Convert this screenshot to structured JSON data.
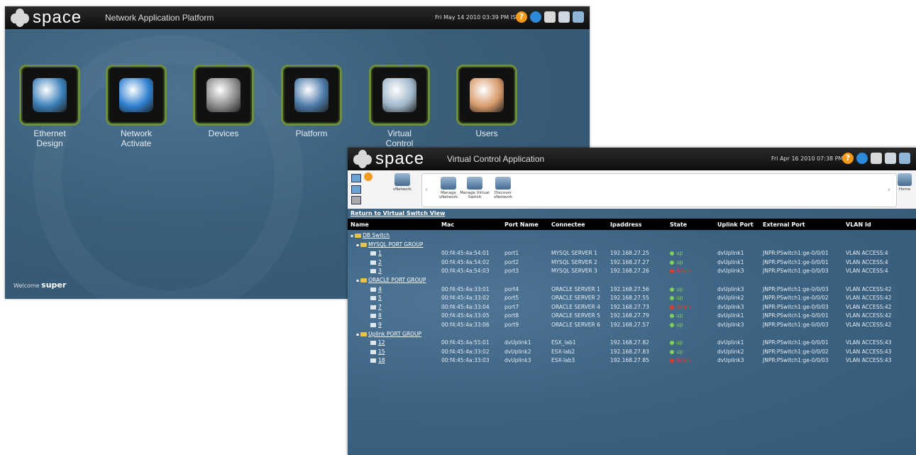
{
  "back_window": {
    "logo_text": "space",
    "title": "Network Application Platform",
    "clock": "Fri May 14 2010 03:39 PM IST",
    "tiles": [
      {
        "label": "Ethernet\nDesign",
        "icon": "cloud-building-icon"
      },
      {
        "label": "Network\nActivate",
        "icon": "globe-network-icon"
      },
      {
        "label": "Devices",
        "icon": "server-rack-icon"
      },
      {
        "label": "Platform",
        "icon": "platform-window-icon"
      },
      {
        "label": "Virtual\nControl",
        "icon": "virtual-device-icon"
      },
      {
        "label": "Users",
        "icon": "user-person-icon"
      }
    ],
    "welcome_label": "Welcome",
    "welcome_user": "super"
  },
  "front_window": {
    "logo_text": "space",
    "title": "Virtual Control Application",
    "clock": "Fri Apr 16 2010 07:38 PM IST",
    "toolbar": {
      "items": [
        {
          "label": "vNetwork"
        },
        {
          "label": "Manage\nvNetwork"
        },
        {
          "label": "Manage Virtual\nSwitch"
        },
        {
          "label": "Discover\nvNetwork"
        }
      ],
      "home_label": "Home"
    },
    "return_link": "Return to Virtual Switch View",
    "columns": [
      "Name",
      "Mac",
      "Port Name",
      "Connectee",
      "Ipaddress",
      "State",
      "Uplink Port",
      "External Port",
      "VLAN Id"
    ],
    "tree": {
      "root": "DB Switch",
      "groups": [
        {
          "name": "MYSQL PORT GROUP",
          "rows": [
            {
              "name": "1",
              "mac": "00:f4:45:4a:54:01",
              "port": "port1",
              "connectee": "MYSQL SERVER 1",
              "ip": "192.168.27.25",
              "state": "up",
              "uplink": "dvUplink1",
              "external": "JNPR:PSwitch1:ge-0/0/01",
              "vlan": "VLAN ACCESS:4"
            },
            {
              "name": "2",
              "mac": "00:f4:45:4a:54:02",
              "port": "port2",
              "connectee": "MYSQL SERVER 2",
              "ip": "192.168.27.27",
              "state": "up",
              "uplink": "dvUplink1",
              "external": "JNPR:PSwitch1:ge-0/0/01",
              "vlan": "VLAN ACCESS:4"
            },
            {
              "name": "3",
              "mac": "00:f4:45:4a:54:03",
              "port": "port3",
              "connectee": "MYSQL SERVER 3",
              "ip": "192.168.27.26",
              "state": "down",
              "uplink": "dvUplink3",
              "external": "JNPR:PSwitch1:ge-0/0/03",
              "vlan": "VLAN ACCESS:4"
            }
          ]
        },
        {
          "name": "ORACLE PORT GROUP",
          "rows": [
            {
              "name": "4",
              "mac": "00:f4:45:4a:33:01",
              "port": "port4",
              "connectee": "ORACLE SERVER 1",
              "ip": "192.168.27.56",
              "state": "up",
              "uplink": "dvUplink3",
              "external": "JNPR:PSwitch1:ge-0/0/03",
              "vlan": "VLAN ACCESS:42"
            },
            {
              "name": "5",
              "mac": "00:f4:45:4a:33:02",
              "port": "port5",
              "connectee": "ORACLE SERVER 2",
              "ip": "192.168.27.55",
              "state": "up",
              "uplink": "dvUplink2",
              "external": "JNPR:PSwitch1:ge-0/0/02",
              "vlan": "VLAN ACCESS:42"
            },
            {
              "name": "7",
              "mac": "00:f4:45:4a:33:04",
              "port": "port7",
              "connectee": "ORACLE SERVER 4",
              "ip": "192.168.27.73",
              "state": "down",
              "uplink": "dvUplink3",
              "external": "JNPR:PSwitch1:ge-0/0/03",
              "vlan": "VLAN ACCESS:42"
            },
            {
              "name": "8",
              "mac": "00:f4:45:4a:33:05",
              "port": "port8",
              "connectee": "ORACLE SERVER 5",
              "ip": "192.168.27.79",
              "state": "up",
              "uplink": "dvUplink1",
              "external": "JNPR:PSwitch1:ge-0/0/01",
              "vlan": "VLAN ACCESS:42"
            },
            {
              "name": "9",
              "mac": "00:f4:45:4a:33:06",
              "port": "port9",
              "connectee": "ORACLE SERVER 6",
              "ip": "192.168.27.57",
              "state": "up",
              "uplink": "dvUplink3",
              "external": "JNPR:PSwitch1:ge-0/0/03",
              "vlan": "VLAN ACCESS:42"
            }
          ]
        },
        {
          "name": "Uplink PORT GROUP",
          "rows": [
            {
              "name": "12",
              "mac": "00:f4:45:4a:55:01",
              "port": "dvUplink1",
              "connectee": "ESX_lab1",
              "ip": "192.168.27.82",
              "state": "up",
              "uplink": "dvUplink1",
              "external": "JNPR:PSwitch1:ge-0/0/01",
              "vlan": "VLAN ACCESS:43"
            },
            {
              "name": "15",
              "mac": "00:f4:45:4a:33:02",
              "port": "dvUplink2",
              "connectee": "ESX-lab2",
              "ip": "192.168.27.83",
              "state": "up",
              "uplink": "dvUplink2",
              "external": "JNPR:PSwitch1:ge-0/0/02",
              "vlan": "VLAN ACCESS:43"
            },
            {
              "name": "18",
              "mac": "00:f4:45:4a:33:03",
              "port": "dvUplink3",
              "connectee": "ESX-lab3",
              "ip": "192.168.27.85",
              "state": "down",
              "uplink": "dvUplink3",
              "external": "JNPR:PSwitch1:ge-0/0/03",
              "vlan": "VLAN ACCESS:43"
            }
          ]
        }
      ]
    }
  },
  "colors": {
    "bg_blue": "#3a5e78",
    "tile_border": "#6e8f39",
    "up": "#7fcf5f",
    "down": "#e03c2c"
  }
}
